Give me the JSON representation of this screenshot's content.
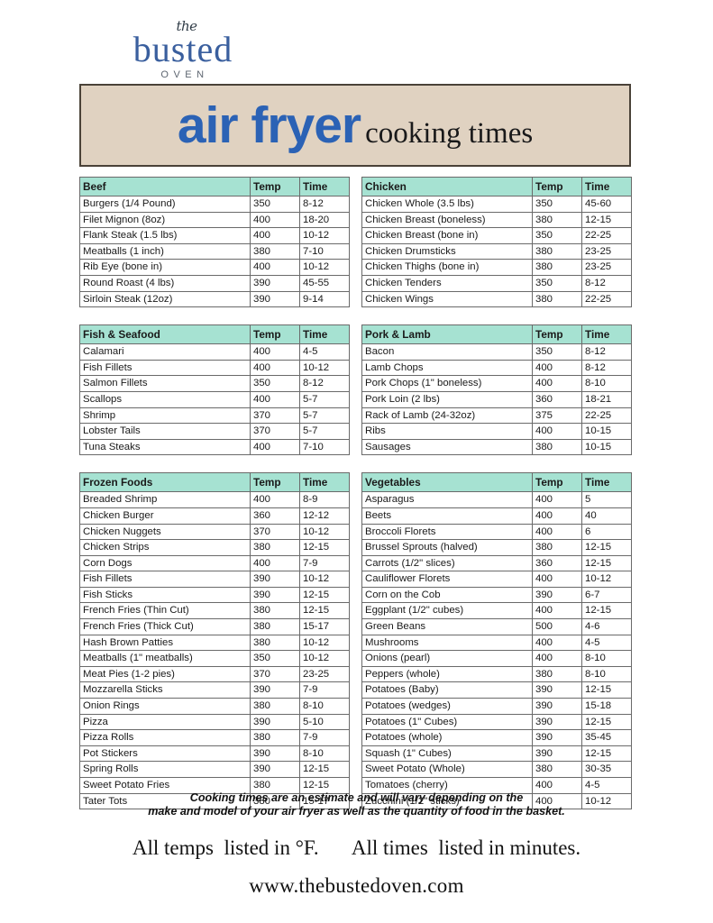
{
  "logo": {
    "script_word": "the",
    "main_word": "busted",
    "sub_word": "OVEN"
  },
  "banner": {
    "title_main": "air fryer",
    "title_sub": "cooking times",
    "bg_color": "#e0d2c1",
    "accent_color": "#2b62b5"
  },
  "theme": {
    "table_header_color": "#a6e2d2",
    "border_color": "#6a6a6a"
  },
  "columns": {
    "temp": "Temp",
    "time": "Time"
  },
  "tables": [
    {
      "id": "beef",
      "title": "Beef",
      "column": "left",
      "rows": [
        [
          "Burgers (1/4 Pound)",
          "350",
          "8-12"
        ],
        [
          "Filet Mignon (8oz)",
          "400",
          "18-20"
        ],
        [
          "Flank Steak (1.5 lbs)",
          "400",
          "10-12"
        ],
        [
          "Meatballs (1 inch)",
          "380",
          "7-10"
        ],
        [
          "Rib Eye (bone in)",
          "400",
          "10-12"
        ],
        [
          "Round Roast (4 lbs)",
          "390",
          "45-55"
        ],
        [
          "Sirloin Steak (12oz)",
          "390",
          "9-14"
        ]
      ]
    },
    {
      "id": "chicken",
      "title": "Chicken",
      "column": "right",
      "rows": [
        [
          "Chicken Whole (3.5 lbs)",
          "350",
          "45-60"
        ],
        [
          "Chicken Breast (boneless)",
          "380",
          "12-15"
        ],
        [
          "Chicken Breast (bone in)",
          "350",
          "22-25"
        ],
        [
          "Chicken Drumsticks",
          "380",
          "23-25"
        ],
        [
          "Chicken Thighs (bone in)",
          "380",
          "23-25"
        ],
        [
          "Chicken Tenders",
          "350",
          "8-12"
        ],
        [
          "Chicken Wings",
          "380",
          "22-25"
        ]
      ]
    },
    {
      "id": "fish-seafood",
      "title": "Fish & Seafood",
      "column": "left",
      "rows": [
        [
          "Calamari",
          "400",
          "4-5"
        ],
        [
          "Fish Fillets",
          "400",
          "10-12"
        ],
        [
          "Salmon Fillets",
          "350",
          "8-12"
        ],
        [
          "Scallops",
          "400",
          "5-7"
        ],
        [
          "Shrimp",
          "370",
          "5-7"
        ],
        [
          "Lobster Tails",
          "370",
          "5-7"
        ],
        [
          "Tuna Steaks",
          "400",
          "7-10"
        ]
      ]
    },
    {
      "id": "pork-lamb",
      "title": "Pork & Lamb",
      "column": "right",
      "rows": [
        [
          "Bacon",
          "350",
          "8-12"
        ],
        [
          "Lamb Chops",
          "400",
          "8-12"
        ],
        [
          "Pork Chops (1\" boneless)",
          "400",
          "8-10"
        ],
        [
          "Pork Loin (2 lbs)",
          "360",
          "18-21"
        ],
        [
          "Rack of Lamb (24-32oz)",
          "375",
          "22-25"
        ],
        [
          "Ribs",
          "400",
          "10-15"
        ],
        [
          "Sausages",
          "380",
          "10-15"
        ]
      ]
    },
    {
      "id": "frozen-foods",
      "title": "Frozen Foods",
      "column": "left",
      "rows": [
        [
          "Breaded Shrimp",
          "400",
          "8-9"
        ],
        [
          "Chicken Burger",
          "360",
          "12-12"
        ],
        [
          "Chicken Nuggets",
          "370",
          "10-12"
        ],
        [
          "Chicken Strips",
          "380",
          "12-15"
        ],
        [
          "Corn Dogs",
          "400",
          "7-9"
        ],
        [
          "Fish Fillets",
          "390",
          "10-12"
        ],
        [
          "Fish Sticks",
          "390",
          "12-15"
        ],
        [
          "French Fries (Thin Cut)",
          "380",
          "12-15"
        ],
        [
          "French Fries (Thick Cut)",
          "380",
          "15-17"
        ],
        [
          "Hash Brown Patties",
          "380",
          "10-12"
        ],
        [
          "Meatballs (1\" meatballs)",
          "350",
          "10-12"
        ],
        [
          "Meat Pies (1-2 pies)",
          "370",
          "23-25"
        ],
        [
          "Mozzarella Sticks",
          "390",
          "7-9"
        ],
        [
          "Onion Rings",
          "380",
          "8-10"
        ],
        [
          "Pizza",
          "390",
          "5-10"
        ],
        [
          "Pizza Rolls",
          "380",
          "7-9"
        ],
        [
          "Pot Stickers",
          "390",
          "8-10"
        ],
        [
          "Spring Rolls",
          "390",
          "12-15"
        ],
        [
          "Sweet Potato Fries",
          "380",
          "12-15"
        ],
        [
          "Tater Tots",
          "380",
          "15-17"
        ]
      ]
    },
    {
      "id": "vegetables",
      "title": "Vegetables",
      "column": "right",
      "rows": [
        [
          "Asparagus",
          "400",
          "5"
        ],
        [
          "Beets",
          "400",
          "40"
        ],
        [
          "Broccoli Florets",
          "400",
          "6"
        ],
        [
          "Brussel Sprouts (halved)",
          "380",
          "12-15"
        ],
        [
          "Carrots (1/2\" slices)",
          "360",
          "12-15"
        ],
        [
          "Cauliflower Florets",
          "400",
          "10-12"
        ],
        [
          "Corn on the Cob",
          "390",
          "6-7"
        ],
        [
          "Eggplant (1/2\" cubes)",
          "400",
          "12-15"
        ],
        [
          "Green Beans",
          "500",
          "4-6"
        ],
        [
          "Mushrooms",
          "400",
          "4-5"
        ],
        [
          "Onions (pearl)",
          "400",
          "8-10"
        ],
        [
          "Peppers (whole)",
          "380",
          "8-10"
        ],
        [
          "Potatoes (Baby)",
          "390",
          "12-15"
        ],
        [
          "Potatoes (wedges)",
          "390",
          "15-18"
        ],
        [
          "Potatoes (1\" Cubes)",
          "390",
          "12-15"
        ],
        [
          "Potatoes (whole)",
          "390",
          "35-45"
        ],
        [
          "Squash (1\" Cubes)",
          "390",
          "12-15"
        ],
        [
          "Sweet Potato (Whole)",
          "380",
          "30-35"
        ],
        [
          "Tomatoes (cherry)",
          "400",
          "4-5"
        ],
        [
          "Zucchini (1/2\" sticks)",
          "400",
          "10-12"
        ]
      ]
    }
  ],
  "footer": {
    "disclaimer_line1": "Cooking times are an estimate and will vary depending on the",
    "disclaimer_line2": "make and model of your air fryer as well as the quantity of food in the basket.",
    "temps_note_lead": "All temps",
    "temps_note_rest": "listed in °F.",
    "times_note_lead": "All times",
    "times_note_rest": "listed in minutes.",
    "website": "www.thebustedoven.com"
  }
}
